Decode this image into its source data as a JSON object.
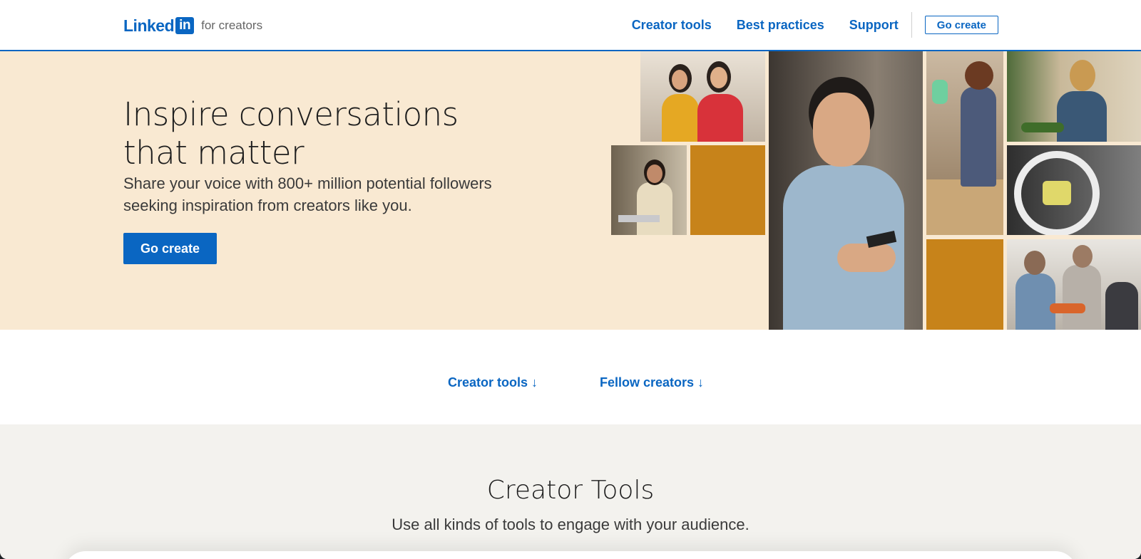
{
  "header": {
    "logo_word": "Linked",
    "logo_box": "in",
    "logo_sub": "for creators",
    "nav": [
      "Creator tools",
      "Best practices",
      "Support"
    ],
    "cta": "Go create"
  },
  "hero": {
    "title": "Inspire conversations that matter",
    "subtitle": "Share your voice with 800+ million potential followers seeking inspiration from creators like you.",
    "cta": "Go create"
  },
  "quick_links": [
    "Creator tools ↓",
    "Fellow creators ↓"
  ],
  "tools": {
    "title": "Creator Tools",
    "subtitle": "Use all kinds of tools to engage with your audience."
  },
  "colors": {
    "brand": "#0a66c2",
    "hero_bg": "#f9e9d2",
    "mustard": "#c7831a",
    "section_bg": "#f3f2ee"
  }
}
